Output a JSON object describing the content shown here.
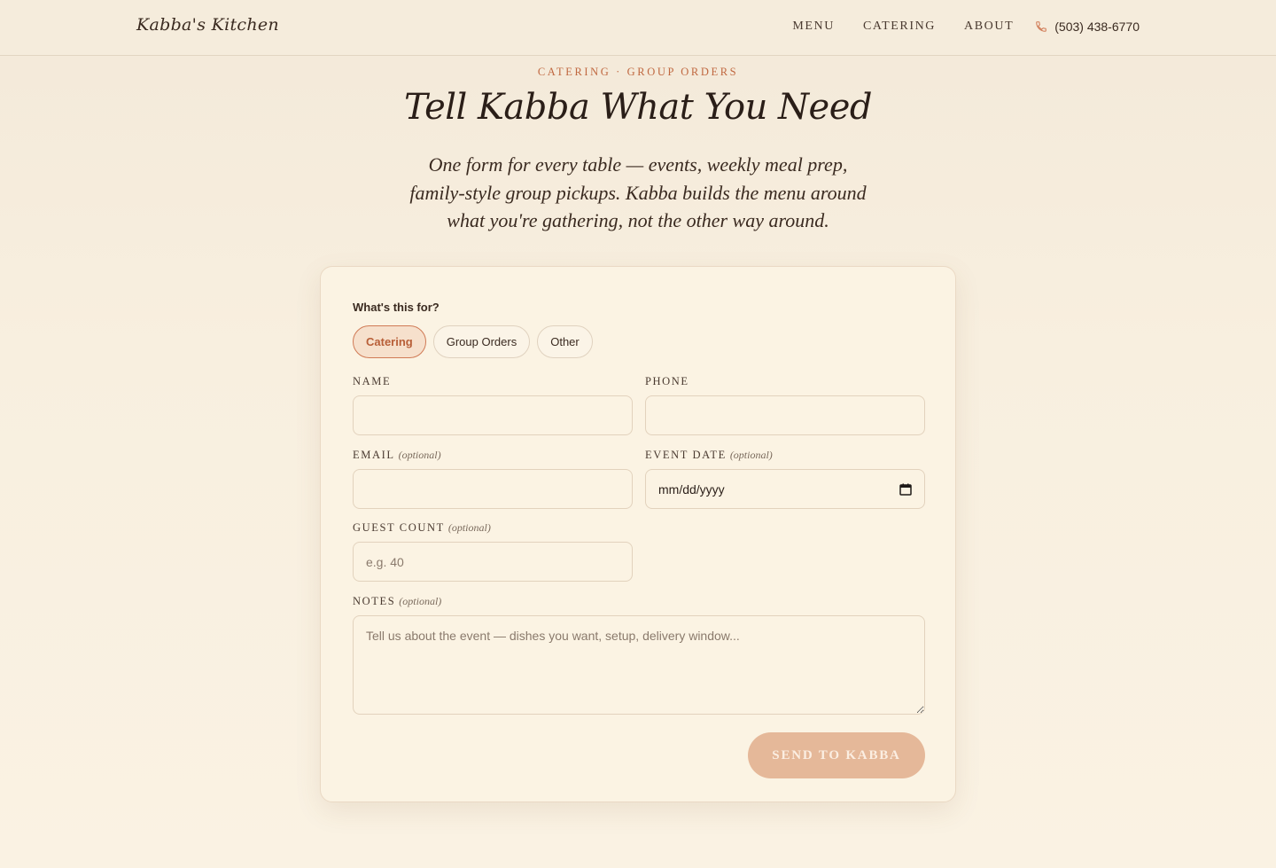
{
  "header": {
    "logo": "Kabba's Kitchen",
    "nav": [
      "MENU",
      "CATERING",
      "ABOUT"
    ],
    "phone": "(503) 438-6770"
  },
  "hero": {
    "eyebrow": "CATERING · GROUP ORDERS",
    "title": "Tell Kabba What You Need",
    "subtitle": "One form for every table — events, weekly meal prep, family-style group pickups. Kabba builds the menu around what you're gathering, not the other way around."
  },
  "form": {
    "question": "What's this for?",
    "options": [
      "Catering",
      "Group Orders",
      "Other"
    ],
    "selected": "Catering",
    "optional_tag": "(optional)",
    "name": {
      "label": "NAME",
      "value": ""
    },
    "phone": {
      "label": "PHONE",
      "value": ""
    },
    "email": {
      "label": "EMAIL",
      "value": ""
    },
    "event_date": {
      "label": "EVENT DATE",
      "value": "mm/dd/yyyy"
    },
    "guest_count": {
      "label": "GUEST COUNT",
      "placeholder": "e.g. 40"
    },
    "notes": {
      "label": "NOTES",
      "placeholder": "Tell us about the event — dishes you want, setup, delivery window..."
    },
    "submit": "SEND TO KABBA"
  },
  "colors": {
    "accent": "#c06840",
    "button": "#e5b899",
    "background": "#f8efdf"
  }
}
